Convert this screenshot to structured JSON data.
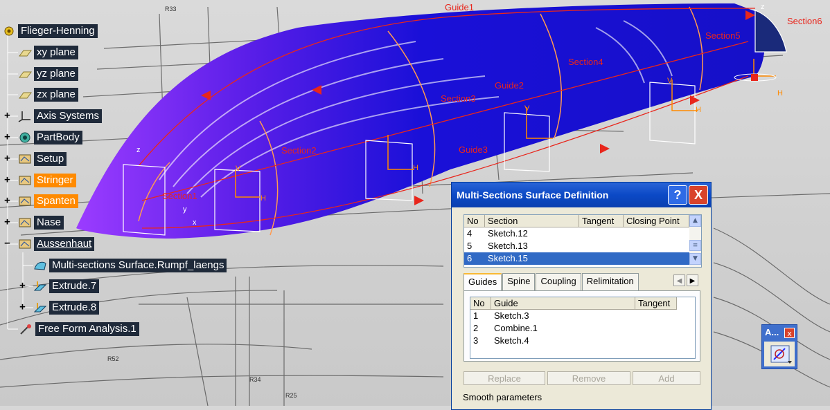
{
  "tree": {
    "root": "Flieger-Henning",
    "items": [
      {
        "label": "xy plane",
        "icon": "plane-icon"
      },
      {
        "label": "yz plane",
        "icon": "plane-icon"
      },
      {
        "label": "zx plane",
        "icon": "plane-icon"
      },
      {
        "label": "Axis Systems",
        "icon": "axis-icon"
      },
      {
        "label": "PartBody",
        "icon": "gear-icon"
      },
      {
        "label": "Setup",
        "icon": "geoset-icon"
      },
      {
        "label": "Stringer",
        "icon": "geoset-icon"
      },
      {
        "label": "Spanten",
        "icon": "geoset-icon"
      },
      {
        "label": "Nase",
        "icon": "geoset-icon"
      },
      {
        "label": "Aussenhaut",
        "icon": "geoset-icon"
      },
      {
        "label": "Multi-sections Surface.Rumpf_laengs",
        "icon": "surface-icon"
      },
      {
        "label": "Extrude.7",
        "icon": "extrude-icon"
      },
      {
        "label": "Extrude.8",
        "icon": "extrude-icon"
      },
      {
        "label": "Free Form Analysis.1",
        "icon": "analysis-icon"
      }
    ]
  },
  "viewport": {
    "labels": {
      "guide1": "Guide1",
      "guide2": "Guide2",
      "guide3": "Guide3",
      "section1": "Section1",
      "section2": "Section2",
      "section3": "Section3",
      "section4": "Section4",
      "section5": "Section5",
      "section6": "Section6"
    },
    "axes": {
      "z": "z",
      "y": "y",
      "x": "x",
      "v": "V",
      "h": "H"
    },
    "drawing_text": {
      "r33": "R33",
      "r52": "R52",
      "r34": "R34",
      "r25": "R25"
    }
  },
  "dialog": {
    "title": "Multi-Sections Surface Definition",
    "help": "?",
    "close": "X",
    "sections": {
      "headers": [
        "No",
        "Section",
        "Tangent",
        "Closing Point"
      ],
      "rows": [
        {
          "no": "4",
          "section": "Sketch.12"
        },
        {
          "no": "5",
          "section": "Sketch.13"
        },
        {
          "no": "6",
          "section": "Sketch.15"
        }
      ]
    },
    "tabs": [
      "Guides",
      "Spine",
      "Coupling",
      "Relimitation"
    ],
    "guides": {
      "headers": [
        "No",
        "Guide",
        "Tangent"
      ],
      "rows": [
        {
          "no": "1",
          "guide": "Sketch.3"
        },
        {
          "no": "2",
          "guide": "Combine.1"
        },
        {
          "no": "3",
          "guide": "Sketch.4"
        }
      ]
    },
    "buttons": {
      "replace": "Replace",
      "remove": "Remove",
      "add": "Add"
    },
    "smooth": "Smooth parameters"
  },
  "mini_toolbar": {
    "title": "A...",
    "close": "x"
  },
  "colors": {
    "surface": "#1a10d8",
    "guide": "#e8261c",
    "section": "#ff9a50",
    "highlight": "#ff8a00"
  }
}
